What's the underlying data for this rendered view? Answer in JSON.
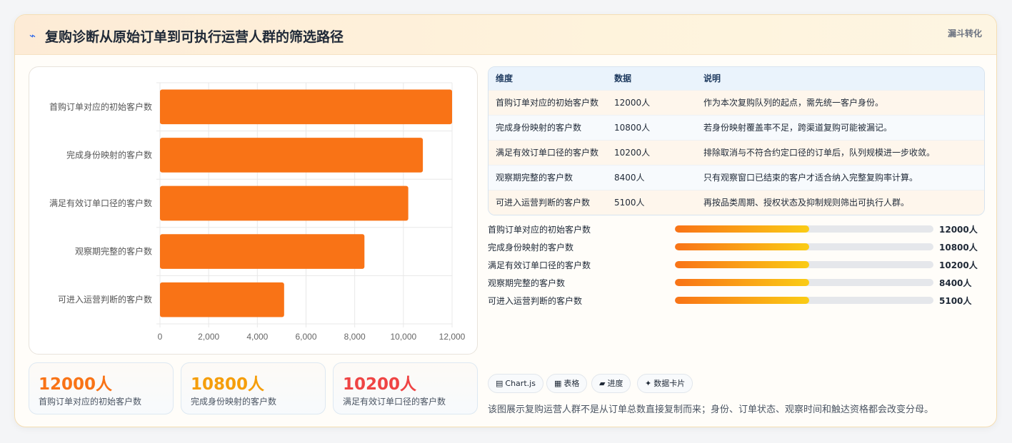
{
  "header": {
    "title": "复购诊断从原始订单到可执行运营人群的筛选路径",
    "tag": "漏斗转化"
  },
  "chart_data": {
    "type": "bar",
    "orientation": "horizontal",
    "categories": [
      "首购订单对应的初始客户数",
      "完成身份映射的客户数",
      "满足有效订单口径的客户数",
      "观察期完整的客户数",
      "可进入运营判断的客户数"
    ],
    "values": [
      12000,
      10800,
      10200,
      8400,
      5100
    ],
    "xticks": [
      "0",
      "2,000",
      "4,000",
      "6,000",
      "8,000",
      "10,000",
      "12,000"
    ],
    "xlim": [
      0,
      12000
    ],
    "bar_color": "#f97316",
    "grid": true
  },
  "stats": [
    {
      "value": "12000人",
      "label": "首购订单对应的初始客户数",
      "color": "#f97316"
    },
    {
      "value": "10800人",
      "label": "完成身份映射的客户数",
      "color": "#f59e0b"
    },
    {
      "value": "10200人",
      "label": "满足有效订单口径的客户数",
      "color": "#ef4444"
    }
  ],
  "table": {
    "headers": [
      "维度",
      "数据",
      "说明"
    ],
    "rows": [
      [
        "首购订单对应的初始客户数",
        "12000人",
        "作为本次复购队列的起点，需先统一客户身份。"
      ],
      [
        "完成身份映射的客户数",
        "10800人",
        "若身份映射覆盖率不足，跨渠道复购可能被漏记。"
      ],
      [
        "满足有效订单口径的客户数",
        "10200人",
        "排除取消与不符合约定口径的订单后，队列规模进一步收敛。"
      ],
      [
        "观察期完整的客户数",
        "8400人",
        "只有观察窗口已结束的客户才适合纳入完整复购率计算。"
      ],
      [
        "可进入运营判断的客户数",
        "5100人",
        "再按品类周期、授权状态及抑制规则筛出可执行人群。"
      ]
    ]
  },
  "progress": [
    {
      "label": "首购订单对应的初始客户数",
      "value": "12000人",
      "fill": 0.52
    },
    {
      "label": "完成身份映射的客户数",
      "value": "10800人",
      "fill": 0.52
    },
    {
      "label": "满足有效订单口径的客户数",
      "value": "10200人",
      "fill": 0.52
    },
    {
      "label": "观察期完整的客户数",
      "value": "8400人",
      "fill": 0.52
    },
    {
      "label": "可进入运营判断的客户数",
      "value": "5100人",
      "fill": 0.52
    }
  ],
  "chips": [
    {
      "icon": "▤",
      "label": "Chart.js"
    },
    {
      "icon": "▦",
      "label": "表格"
    },
    {
      "icon": "▰",
      "label": "进度"
    },
    {
      "icon": "✦",
      "label": "数据卡片"
    }
  ],
  "footnote": "该图展示复购运营人群不是从订单总数直接复制而来；身份、订单状态、观察时间和触达资格都会改变分母。"
}
